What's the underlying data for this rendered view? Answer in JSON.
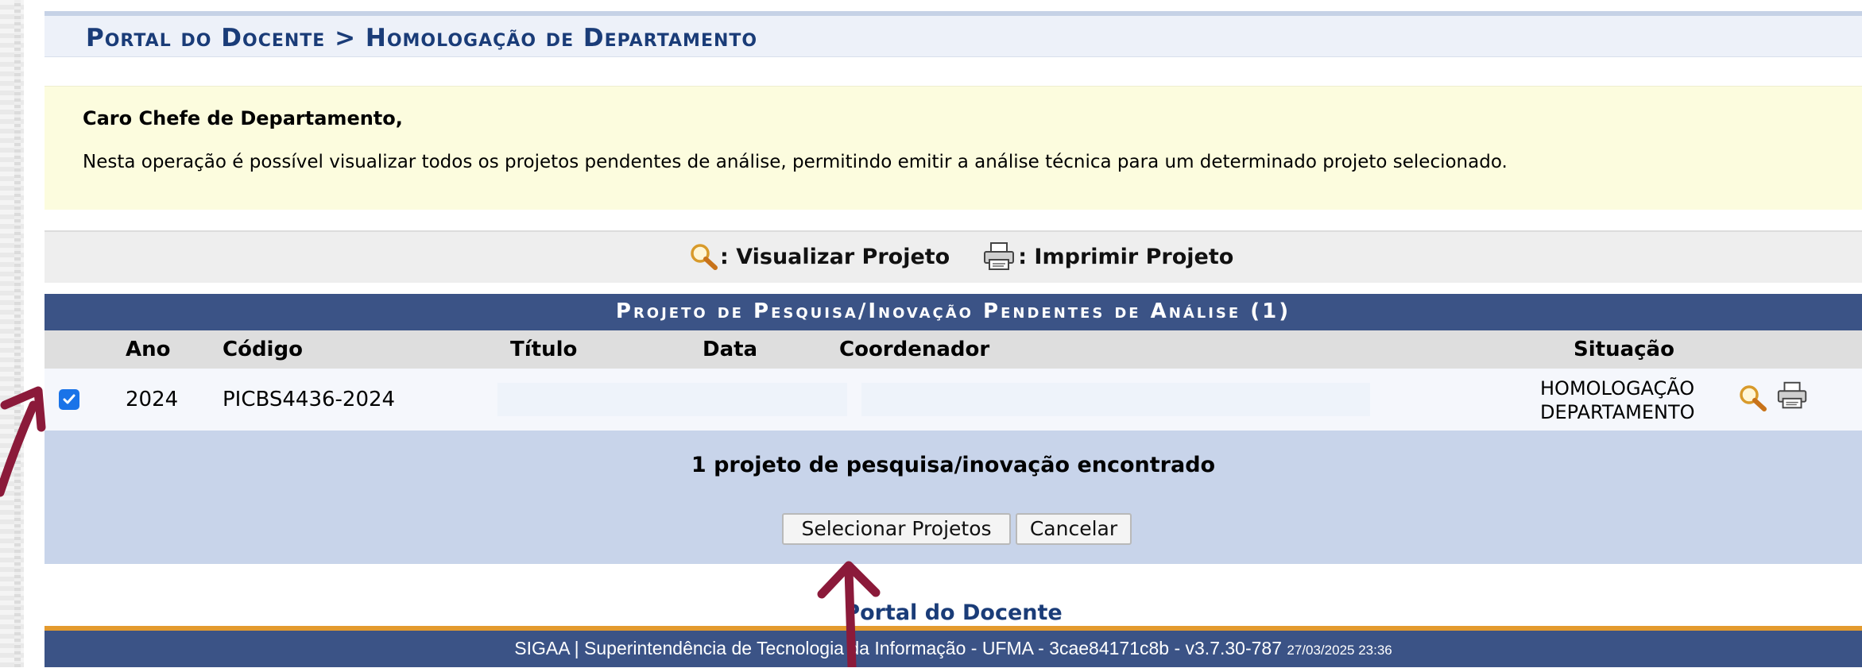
{
  "breadcrumb": "Portal do Docente > Homologação de Departamento",
  "notice": {
    "greeting": "Caro Chefe de Departamento,",
    "message": "Nesta operação é possível visualizar todos os projetos pendentes de análise, permitindo emitir a análise técnica para um determinado projeto selecionado."
  },
  "legend": {
    "view_label": ": Visualizar Projeto",
    "print_label": ": Imprimir Projeto"
  },
  "table": {
    "title": "Projeto de Pesquisa/Inovação Pendentes de Análise (1)",
    "columns": [
      "Ano",
      "Código",
      "Título",
      "Data",
      "Coordenador",
      "Situação"
    ],
    "rows": [
      {
        "checked": true,
        "ano": "2024",
        "codigo": "PICBS4436-2024",
        "titulo": "",
        "data": "",
        "coordenador": "",
        "situacao_line1": "HOMOLOGAÇÃO",
        "situacao_line2": "DEPARTAMENTO"
      }
    ]
  },
  "result_count": "1 projeto de pesquisa/inovação encontrado",
  "buttons": {
    "select": "Selecionar Projetos",
    "cancel": "Cancelar"
  },
  "portal_link": "Portal do Docente",
  "footer": {
    "text": "SIGAA | Superintendência de Tecnologia da Informação - UFMA - 3cae84171c8b - v3.7.30-787",
    "timestamp": "27/03/2025 23:36"
  },
  "colors": {
    "header_blue": "#3b5386",
    "breadcrumb_text": "#1a3c78",
    "notice_bg": "#fcfcde",
    "annotation_arrow": "#8b1a3a"
  }
}
